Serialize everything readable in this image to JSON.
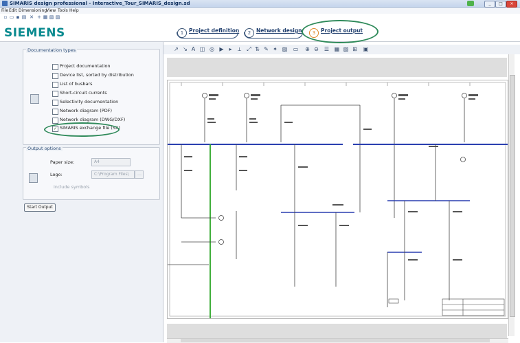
{
  "window": {
    "title": "SIMARIS design professional - Interactive_Tour_SIMARIS_design.sd",
    "minimize": "_",
    "maximize": "□",
    "close": "×"
  },
  "menu": [
    "File",
    "Edit",
    "Dimensioning",
    "View",
    "Tools",
    "Help"
  ],
  "quick_toolbar": [
    "new-icon",
    "open-icon",
    "save-icon",
    "print-icon",
    "delete-icon",
    "add-icon",
    "copy-icon",
    "paste-icon",
    "cut-icon"
  ],
  "logo": "SIEMENS",
  "steps": [
    {
      "num": "1",
      "label": "Project definition"
    },
    {
      "num": "2",
      "label": "Network design"
    },
    {
      "num": "3",
      "label": "Project output"
    }
  ],
  "documentation": {
    "title": "Documentation types",
    "items": [
      {
        "label": "Project documentation",
        "checked": false
      },
      {
        "label": "Device list, sorted by distribution",
        "checked": false
      },
      {
        "label": "List of busbars",
        "checked": false
      },
      {
        "label": "Short-circuit currents",
        "checked": false
      },
      {
        "label": "Selectivity documentation",
        "checked": false
      },
      {
        "label": "Network diagram (PDF)",
        "checked": false
      },
      {
        "label": "Network diagram (DWG/DXF)",
        "checked": false
      },
      {
        "label": "SIMARIS exchange file (SX)",
        "checked": true
      }
    ]
  },
  "output_options": {
    "title": "Output options",
    "paper_size_label": "Paper size:",
    "paper_size_value": "A4",
    "logo_label": "Logo:",
    "logo_value": "C:\\Program Files\\",
    "include_symbols": "include symbols"
  },
  "start_button": "Start Output",
  "drawing_toolbar": [
    "pointer-icon",
    "hand-icon",
    "text-icon",
    "frame-icon",
    "circle-icon",
    "play-icon",
    "forward-icon",
    "measure-icon",
    "fit-icon",
    "split-icon",
    "pen-icon",
    "marker-icon",
    "image-icon",
    "zoom-window-icon",
    "zoom-in-icon",
    "zoom-out-icon",
    "align-icon",
    "grid-icon",
    "layers-icon",
    "export-icon",
    "page-icon"
  ],
  "colors": {
    "accent_ring": "#2f8a5a",
    "busbar": "#2a3fb0",
    "feeder_green": "#3fae3b",
    "brand": "#0a8a8f"
  }
}
